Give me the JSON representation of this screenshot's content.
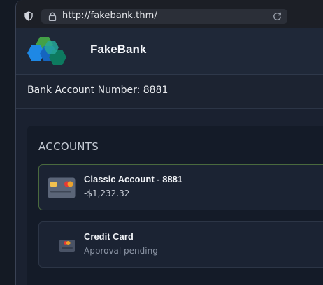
{
  "browser": {
    "url": "http://fakebank.thm/",
    "icons": {
      "shield": "shield-icon",
      "lock": "lock-icon",
      "reload": "reload-icon"
    }
  },
  "header": {
    "brand": "FakeBank",
    "logo": "fakebank-logo",
    "colors": {
      "logo_blue": "#1e88e5",
      "logo_green": "#43a047",
      "logo_teal": "#0d7a5f"
    }
  },
  "account_bar": {
    "label": "Bank Account Number: 8881"
  },
  "accounts": {
    "title": "ACCOUNTS",
    "items": [
      {
        "name": "Classic Account - 8881",
        "detail": "-$1,232.32",
        "icon": "card-icon",
        "state": "selected"
      },
      {
        "name": "Credit Card",
        "detail": "Approval pending",
        "icon": "credit-card-icon",
        "state": "pending"
      }
    ]
  }
}
